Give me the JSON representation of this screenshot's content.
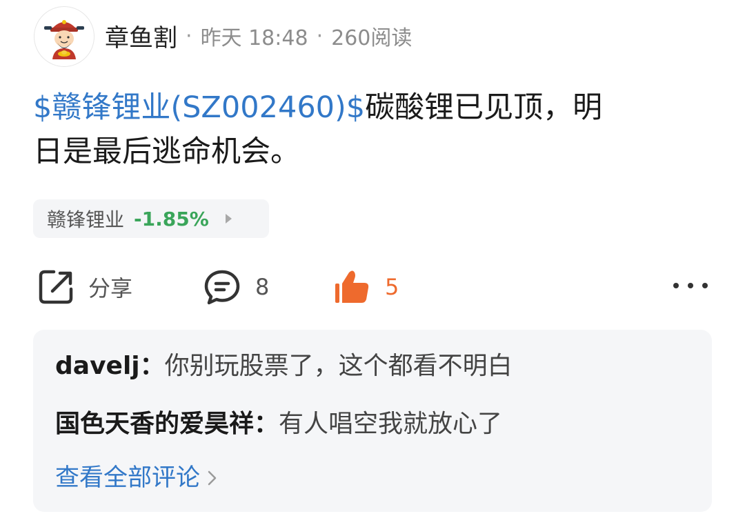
{
  "header": {
    "author": "章鱼割",
    "sep": "·",
    "time": "昨天 18:48",
    "reads": "260阅读",
    "avatar_icon": "cartoon-god-of-wealth-avatar"
  },
  "post": {
    "stock_tag": "$赣锋锂业(SZ002460)$",
    "text_line1": "碳酸锂已见顶，明",
    "text_line2": "日是最后逃命机会。"
  },
  "stock_chip": {
    "name": "赣锋锂业",
    "change": "-1.85%",
    "change_color": "#3aa55a"
  },
  "actions": {
    "share_label": "分享",
    "comment_count": "8",
    "like_count": "5",
    "like_color": "#ee6a2d",
    "share_icon": "share-icon",
    "comment_icon": "comment-bubble-icon",
    "like_icon": "thumbs-up-icon",
    "more_icon": "more-dots-icon"
  },
  "comments": [
    {
      "user": "davelj",
      "sep": "：",
      "text": "你别玩股票了，这个都看不明白"
    },
    {
      "user": "国色天香的爱昊祥",
      "sep": "：",
      "text": "有人唱空我就放心了"
    }
  ],
  "view_all": "查看全部评论",
  "colors": {
    "link_blue": "#3278c8",
    "comment_bg": "#f5f6f8"
  }
}
